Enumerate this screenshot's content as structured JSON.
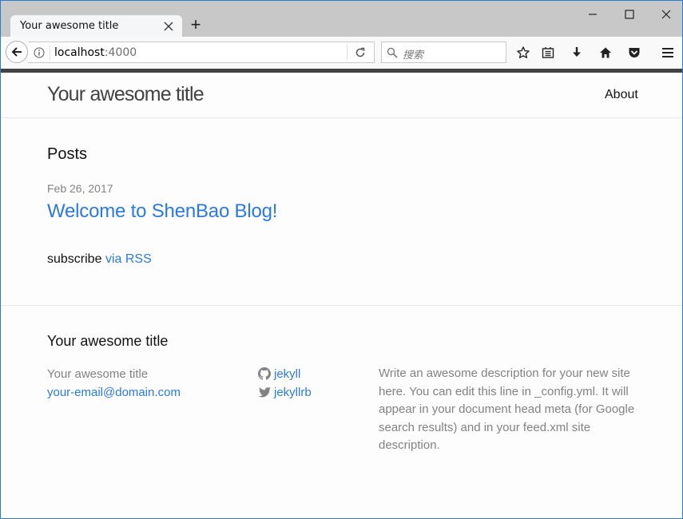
{
  "browser": {
    "tab_title": "Your awesome title",
    "url_host": "localhost",
    "url_port": ":4000",
    "search_placeholder": "搜索",
    "new_tab_label": "+"
  },
  "site": {
    "title": "Your awesome title",
    "nav": [
      {
        "label": "About"
      }
    ]
  },
  "main": {
    "heading": "Posts",
    "posts": [
      {
        "date": "Feb 26, 2017",
        "title": "Welcome to ShenBao Blog!"
      }
    ],
    "subscribe_text": "subscribe",
    "rss_link": "via RSS"
  },
  "footer": {
    "heading": "Your awesome title",
    "name": "Your awesome title",
    "email": "your-email@domain.com",
    "github_user": "jekyll",
    "twitter_user": "jekyllrb",
    "description": "Write an awesome description for your new site here. You can edit this line in _config.yml. It will appear in your document head meta (for Google search results) and in your feed.xml site description."
  },
  "colors": {
    "link": "#2a7ae2",
    "text": "#111111",
    "muted": "#828282",
    "header_bar": "#424242"
  },
  "icons": [
    "close-icon",
    "minimize-icon",
    "maximize-icon",
    "back-arrow-icon",
    "info-icon",
    "reload-icon",
    "search-icon",
    "bookmark-star-icon",
    "reading-list-icon",
    "download-icon",
    "home-icon",
    "pocket-icon",
    "hamburger-menu-icon",
    "github-icon",
    "twitter-icon"
  ]
}
